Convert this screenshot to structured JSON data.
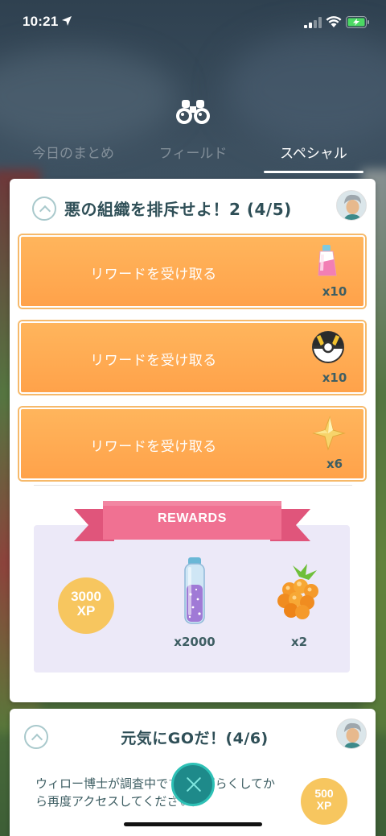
{
  "status_bar": {
    "time": "10:21"
  },
  "tabs": [
    {
      "label": "今日のまとめ",
      "active": false
    },
    {
      "label": "フィールド",
      "active": false
    },
    {
      "label": "スペシャル",
      "active": true
    }
  ],
  "research_1": {
    "title": "悪の組織を排斥せよ！2 (4/5)",
    "reward_buttons": [
      {
        "label": "リワードを受け取る",
        "item": "potion-icon",
        "count": "x10"
      },
      {
        "label": "リワードを受け取る",
        "item": "ultra-ball-icon",
        "count": "x10"
      },
      {
        "label": "リワードを受け取る",
        "item": "star-piece-icon",
        "count": "x6"
      }
    ],
    "rewards_banner": "REWARDS",
    "rewards": {
      "xp_value": "3000",
      "xp_unit": "XP",
      "stardust_count": "x2000",
      "berry_count": "x2"
    }
  },
  "research_2": {
    "title": "元気にGOだ！(4/6)",
    "description": "ウィロー博士が調査中です。しばらくしてから再度アクセスしてください。",
    "xp_value": "500",
    "xp_unit": "XP"
  },
  "colors": {
    "accent_orange": "#ffa24a",
    "ribbon_pink": "#f07192",
    "xp_gold": "#f7c65f",
    "close_teal": "#1e8a8a"
  }
}
